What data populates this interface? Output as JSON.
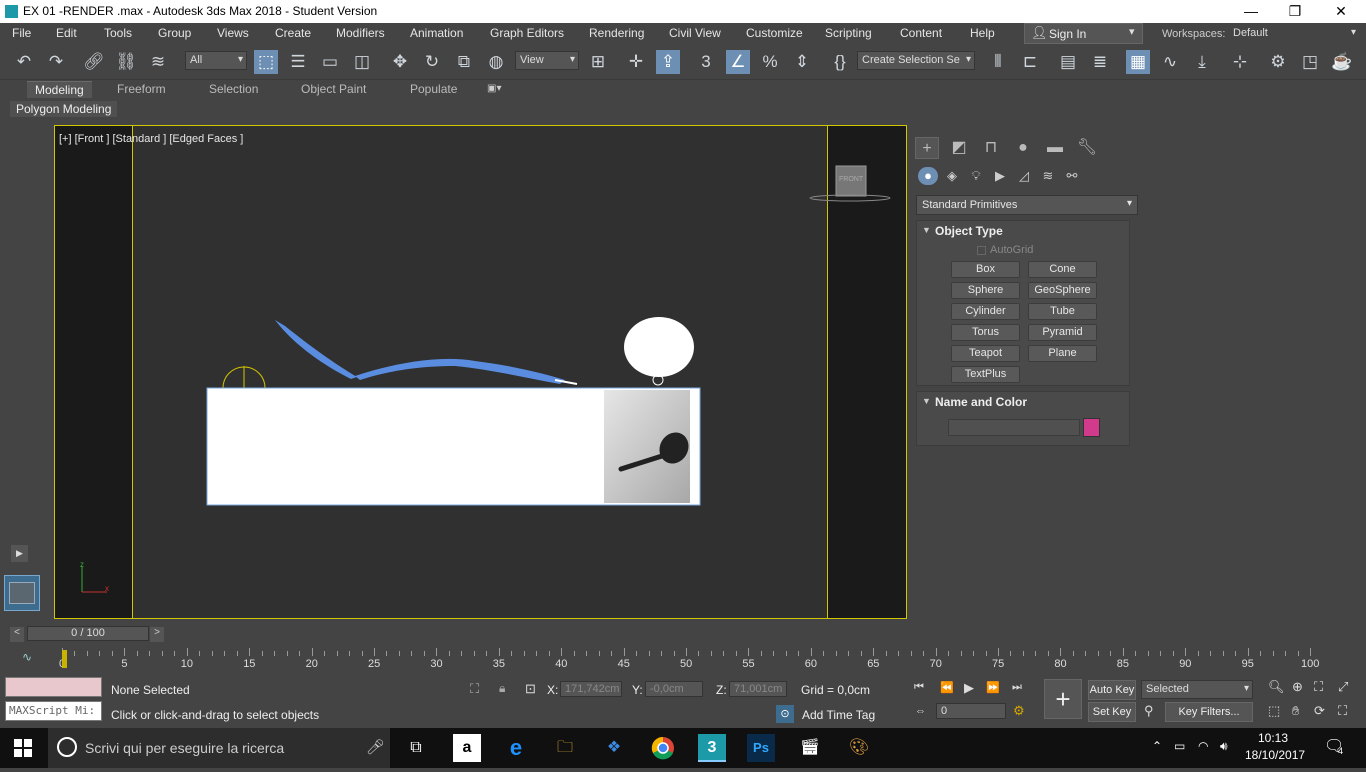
{
  "window": {
    "title": "EX 01 -RENDER .max - Autodesk 3ds Max 2018 - Student Version",
    "minimize": "—",
    "restore": "❐",
    "close": "✕"
  },
  "menu": [
    "File",
    "Edit",
    "Tools",
    "Group",
    "Views",
    "Create",
    "Modifiers",
    "Animation",
    "Graph Editors",
    "Rendering",
    "Civil View",
    "Customize",
    "Scripting",
    "Content",
    "Help"
  ],
  "signin": {
    "label": "Sign In",
    "icon": "user-icon"
  },
  "workspaces": {
    "label": "Workspaces:",
    "value": "Default"
  },
  "toolbar": {
    "filter_value": "All",
    "refcoord_value": "View",
    "selset_value": "Create Selection Se",
    "snap_label": "3"
  },
  "ribbon": {
    "tabs": [
      "Modeling",
      "Freeform",
      "Selection",
      "Object Paint",
      "Populate"
    ],
    "sub": "Polygon Modeling"
  },
  "viewport": {
    "label": "[+] [Front ] [Standard ] [Edged Faces ]",
    "viewcube": "FRONT",
    "axis_z": "z",
    "axis_x": "x"
  },
  "command_panel": {
    "category": "Standard Primitives",
    "object_type": {
      "title": "Object Type",
      "autogrid": "AutoGrid",
      "buttons": [
        "Box",
        "Cone",
        "Sphere",
        "GeoSphere",
        "Cylinder",
        "Tube",
        "Torus",
        "Pyramid",
        "Teapot",
        "Plane",
        "TextPlus"
      ]
    },
    "name_color": {
      "title": "Name and Color",
      "name_value": "",
      "color": "#d23a8c"
    }
  },
  "time": {
    "frame_display": "0 / 100",
    "ticks": [
      "0",
      "5",
      "10",
      "15",
      "20",
      "25",
      "30",
      "35",
      "40",
      "45",
      "50",
      "55",
      "60",
      "65",
      "70",
      "75",
      "80",
      "85",
      "90",
      "95",
      "100"
    ]
  },
  "status": {
    "maxscript": "MAXScript Mi:",
    "selection": "None Selected",
    "prompt": "Click or click-and-drag to select objects",
    "x_label": "X:",
    "x_value": "171,742cm",
    "y_label": "Y:",
    "y_value": "-0,0cm",
    "z_label": "Z:",
    "z_value": "71,001cm",
    "grid": "Grid = 0,0cm",
    "add_time_tag": "Add Time Tag",
    "frame_value": "0",
    "auto_key": "Auto Key",
    "set_key": "Set Key",
    "key_mode": "Selected",
    "key_filters": "Key Filters..."
  },
  "taskbar": {
    "search_placeholder": "Scrivi qui per eseguire la ricerca",
    "time": "10:13",
    "date": "18/10/2017",
    "notifications": "4"
  }
}
